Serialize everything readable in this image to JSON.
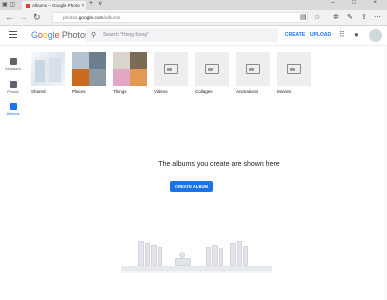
{
  "browser": {
    "tab_title": "Albums – Google Photos",
    "tab_close": "×",
    "new_tab": "+",
    "tab_dropdown": "∨",
    "window_controls": "–  □  ×",
    "address_prefix": "photos.",
    "address_host": "google.com",
    "address_path": "/albums"
  },
  "header": {
    "logo": {
      "g1": "G",
      "g2": "o",
      "g3": "o",
      "g4": "g",
      "g5": "l",
      "g6": "e",
      "product": " Photos"
    },
    "search_placeholder": "Search \"Hong Kong\"",
    "create_label": "CREATE",
    "upload_label": "UPLOAD"
  },
  "sidebar": {
    "items": [
      {
        "label": "Assistant",
        "color": "#5f6368"
      },
      {
        "label": "Photos",
        "color": "#5f6368"
      },
      {
        "label": "Albums",
        "color": "#1a73e8"
      }
    ]
  },
  "categories": [
    {
      "label": "Shared"
    },
    {
      "label": "Places"
    },
    {
      "label": "Things"
    },
    {
      "label": "Videos"
    },
    {
      "label": "Collages"
    },
    {
      "label": "Animations"
    },
    {
      "label": "Movies"
    }
  ],
  "empty_state": {
    "message": "The albums you create are shown here",
    "button_label": "CREATE ALBUM"
  },
  "colors": {
    "accent": "#1a73e8"
  }
}
